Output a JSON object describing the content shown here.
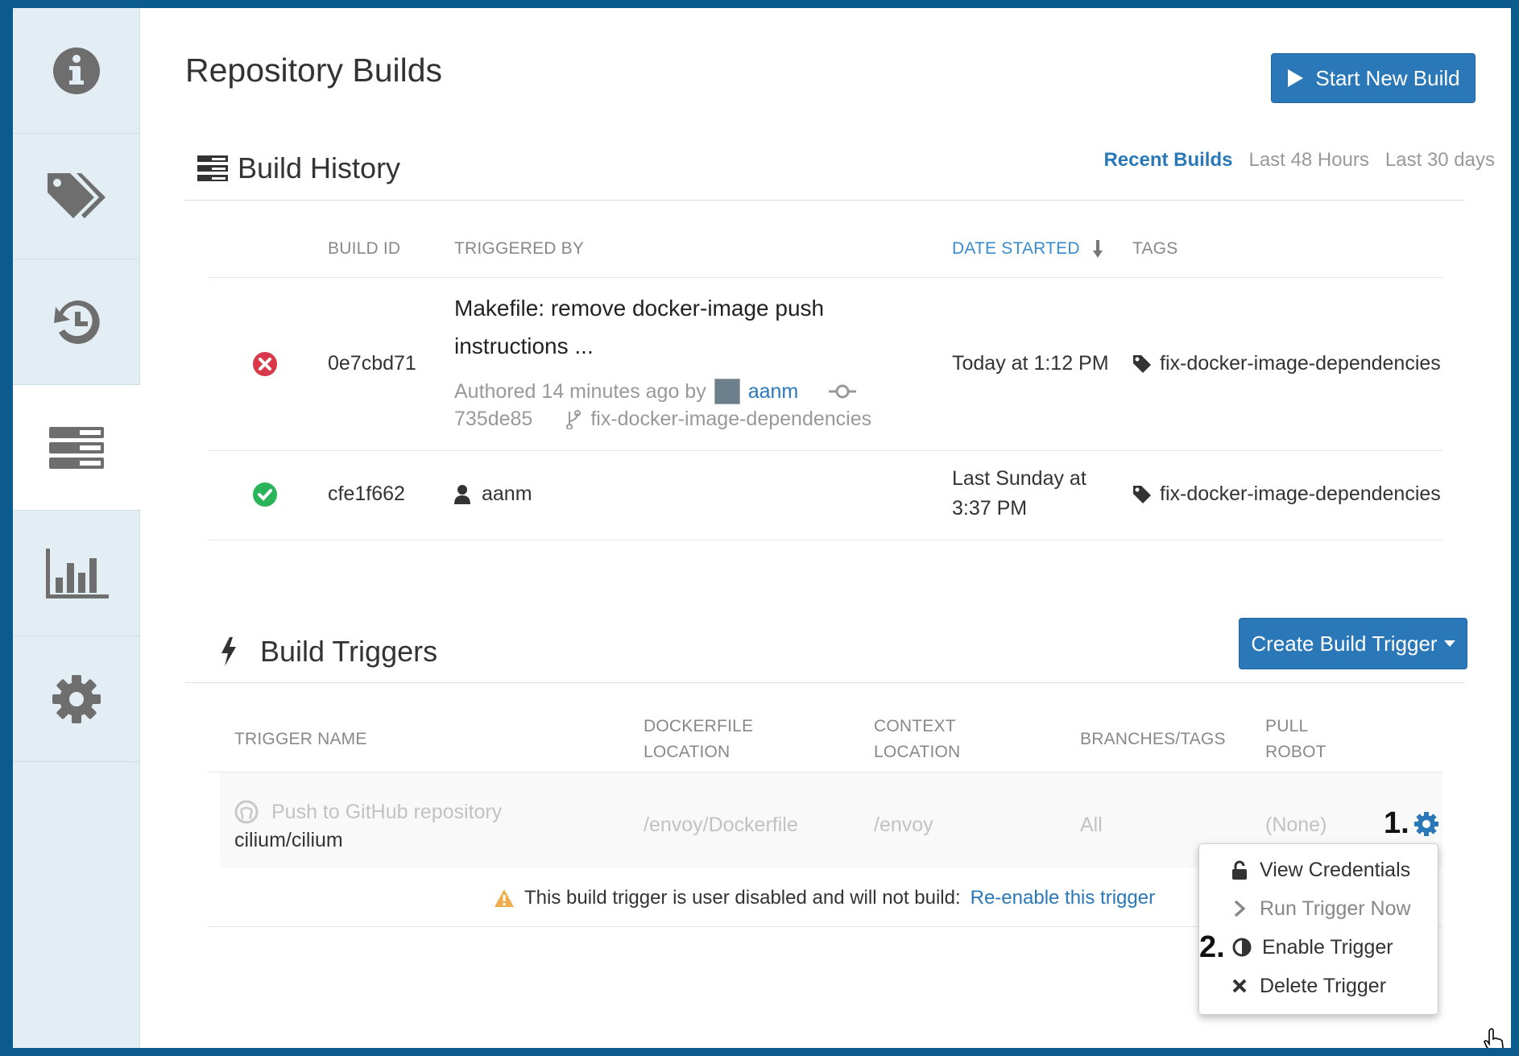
{
  "sidebar": {
    "items": [
      {
        "icon": "info-icon"
      },
      {
        "icon": "tags-icon"
      },
      {
        "icon": "history-icon"
      },
      {
        "icon": "builds-icon",
        "active": true
      },
      {
        "icon": "usage-chart-icon"
      },
      {
        "icon": "settings-gear-icon"
      }
    ]
  },
  "header": {
    "title": "Repository Builds",
    "start_build_label": "Start New Build"
  },
  "build_history": {
    "title": "Build History",
    "filters": [
      "Recent Builds",
      "Last 48 Hours",
      "Last 30 days"
    ],
    "columns": {
      "build_id": "BUILD ID",
      "triggered_by": "TRIGGERED BY",
      "date_started": "DATE STARTED",
      "tags": "TAGS"
    },
    "rows": [
      {
        "status": "failed",
        "build_id": "0e7cbd71",
        "commit_message_line1": "Makefile: remove docker-image push",
        "commit_message_line2": "instructions  ...",
        "authored_prefix": "Authored 14 minutes ago by",
        "author": "aanm",
        "commit_sha": "735de85",
        "branch": "fix-docker-image-dependencies",
        "date": "Today at 1:12 PM",
        "tag": "fix-docker-image-dependencies"
      },
      {
        "status": "success",
        "build_id": "cfe1f662",
        "triggered_user": "aanm",
        "date_line1": "Last Sunday at",
        "date_line2": "3:37 PM",
        "tag": "fix-docker-image-dependencies"
      }
    ]
  },
  "build_triggers": {
    "title": "Build Triggers",
    "create_label": "Create Build Trigger",
    "columns": {
      "trigger_name": "TRIGGER NAME",
      "dockerfile_1": "DOCKERFILE",
      "dockerfile_2": "LOCATION",
      "context_1": "CONTEXT",
      "context_2": "LOCATION",
      "branches": "BRANCHES/TAGS",
      "robot_1": "PULL",
      "robot_2": "ROBOT"
    },
    "trigger": {
      "name": "Push to GitHub repository",
      "repo": "cilium/cilium",
      "dockerfile": "/envoy/Dockerfile",
      "context": "/envoy",
      "branches": "All",
      "robot": "(None)"
    },
    "warning_text": "This build trigger is user disabled and will not build:",
    "reenable_link": "Re-enable this trigger"
  },
  "dropdown_menu": {
    "items": [
      {
        "label": "View Credentials",
        "icon": "unlock-icon"
      },
      {
        "label": "Run Trigger Now",
        "icon": "chevron-right-icon"
      },
      {
        "label": "Enable Trigger",
        "icon": "half-circle-icon"
      },
      {
        "label": "Delete Trigger",
        "icon": "close-x-icon"
      }
    ]
  },
  "annotations": {
    "step1": "1.",
    "step2": "2."
  },
  "colors": {
    "accent": "#2a78b8",
    "failed": "#d9384a",
    "success": "#2bb55b",
    "warning": "#f0ad4e"
  }
}
